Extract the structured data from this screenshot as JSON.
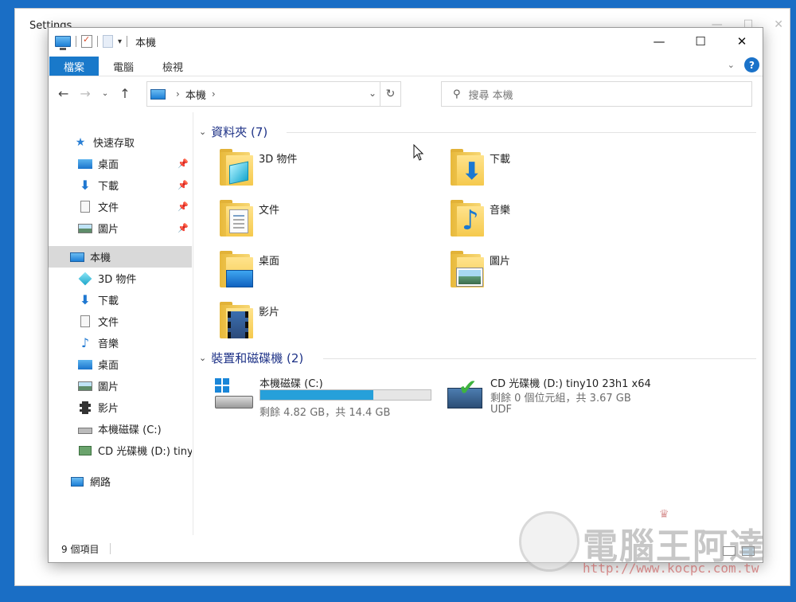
{
  "background_window": {
    "title": "Settings"
  },
  "window": {
    "title": "本機",
    "controls": {
      "minimize": "—",
      "maximize": "☐",
      "close": "✕"
    }
  },
  "ribbon": {
    "tabs": [
      {
        "label": "檔案"
      },
      {
        "label": "電腦"
      },
      {
        "label": "檢視"
      }
    ],
    "help_icon": "?"
  },
  "address": {
    "breadcrumb": "本機",
    "search_placeholder": "搜尋 本機"
  },
  "nav_pane": {
    "quick_access": "快速存取",
    "quick_items": [
      {
        "label": "桌面"
      },
      {
        "label": "下載"
      },
      {
        "label": "文件"
      },
      {
        "label": "圖片"
      }
    ],
    "this_pc": "本機",
    "pc_items": [
      {
        "label": "3D 物件"
      },
      {
        "label": "下載"
      },
      {
        "label": "文件"
      },
      {
        "label": "音樂"
      },
      {
        "label": "桌面"
      },
      {
        "label": "圖片"
      },
      {
        "label": "影片"
      },
      {
        "label": "本機磁碟 (C:)"
      },
      {
        "label": "CD 光碟機 (D:) tiny"
      }
    ],
    "network": "網路"
  },
  "content": {
    "folders_header": "資料夾 (7)",
    "folders": [
      {
        "label": "3D 物件",
        "icon": "3d-objects-icon"
      },
      {
        "label": "下載",
        "icon": "download-icon"
      },
      {
        "label": "文件",
        "icon": "documents-icon"
      },
      {
        "label": "音樂",
        "icon": "music-icon"
      },
      {
        "label": "桌面",
        "icon": "desktop-icon"
      },
      {
        "label": "圖片",
        "icon": "pictures-icon"
      },
      {
        "label": "影片",
        "icon": "videos-icon"
      }
    ],
    "drives_header": "裝置和磁碟機 (2)",
    "drives": [
      {
        "label": "本機磁碟 (C:)",
        "used_fraction": 0.665,
        "detail": "剩餘 4.82 GB，共 14.4 GB"
      },
      {
        "label": "CD 光碟機 (D:) tiny10 23h1 x64",
        "detail": "剩餘 0 個位元組，共 3.67 GB",
        "fs": "UDF"
      }
    ]
  },
  "status": {
    "item_count": "9 個項目"
  },
  "watermark": {
    "brand": "電腦王阿達",
    "url": "http://www.kocpc.com.tw"
  },
  "colors": {
    "accent": "#1979ca",
    "folder_header": "#1e3287",
    "bar_fill": "#26a0da"
  }
}
